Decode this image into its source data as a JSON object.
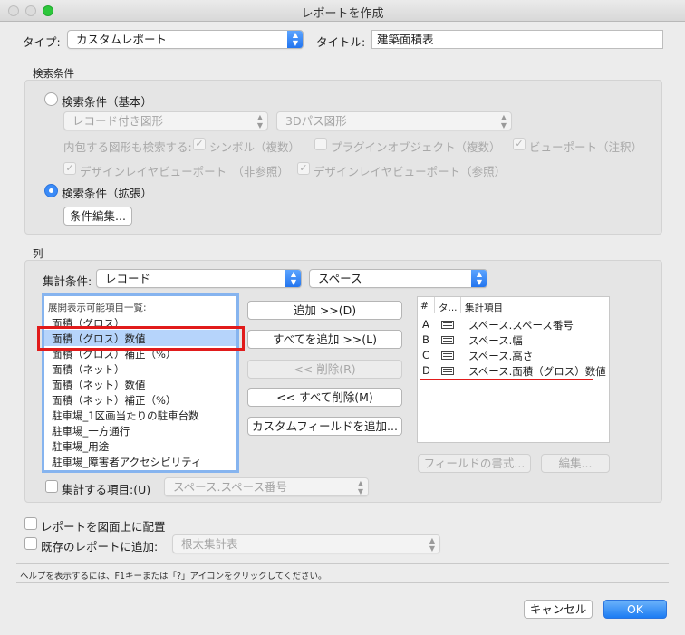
{
  "window": {
    "title": "レポートを作成"
  },
  "type_label": "タイプ:",
  "type_value": "カスタムレポート",
  "title_label": "タイトル:",
  "title_value": "建築面積表",
  "search": {
    "section": "検索条件",
    "basic_label": "検索条件（基本）",
    "record_popup": "レコード付き図形",
    "path_popup": "3Dパス図形",
    "include_label": "内包する図形も検索する:",
    "symbol": "シンボル（複数）",
    "plugin": "プラグインオブジェクト（複数）",
    "viewport": "ビューポート（注釈）",
    "dlvp_noref": "デザインレイヤビューポート　（非参照）",
    "dlvp_ref": "デザインレイヤビューポート（参照）",
    "advanced_label": "検索条件（拡張）",
    "edit_button": "条件編集..."
  },
  "columns": {
    "section": "列",
    "agg_label": "集計条件:",
    "agg_value": "レコード",
    "record_value": "スペース",
    "available_header": "展開表示可能項目一覧:",
    "available_items": [
      "面積（グロス）",
      "面積（グロス）数値",
      "面積（グロス）補正（%）",
      "面積（ネット）",
      "面積（ネット）数値",
      "面積（ネット）補正（%）",
      "駐車場_1区画当たりの駐車台数",
      "駐車場_一方通行",
      "駐車場_用途",
      "駐車場_障害者アクセシビリティ"
    ],
    "add_button": "追加 >>(D)",
    "add_all_button": "すべてを追加 >>(L)",
    "remove_button": "<< 削除(R)",
    "remove_all_button": "<< すべて削除(M)",
    "custom_field_button": "カスタムフィールドを追加...",
    "table_headers": {
      "num": "#",
      "type": "タ...",
      "item": "集計項目"
    },
    "rows": [
      {
        "letter": "A",
        "icon": "record-field-icon",
        "item": "スペース.スペース番号"
      },
      {
        "letter": "B",
        "icon": "record-field-icon",
        "item": "スペース.幅"
      },
      {
        "letter": "C",
        "icon": "record-field-icon",
        "item": "スペース.高さ"
      },
      {
        "letter": "D",
        "icon": "record-field-icon",
        "item": "スペース.面積（グロス）数値"
      }
    ],
    "field_format_button": "フィールドの書式...",
    "edit_button": "編集...",
    "summarize_label": "集計する項目:(U)",
    "summarize_value": "スペース.スペース番号"
  },
  "place_on_drawing": "レポートを図面上に配置",
  "add_to_existing": "既存のレポートに追加:",
  "existing_value": "根太集計表",
  "help_text": "ヘルプを表示するには、F1キーまたは「?」アイコンをクリックしてください。",
  "cancel_button": "キャンセル",
  "ok_button": "OK",
  "colors": {
    "accent": "#1c7cf3",
    "highlight": "#b6d4fb",
    "annotation_red": "#e11b1b"
  }
}
